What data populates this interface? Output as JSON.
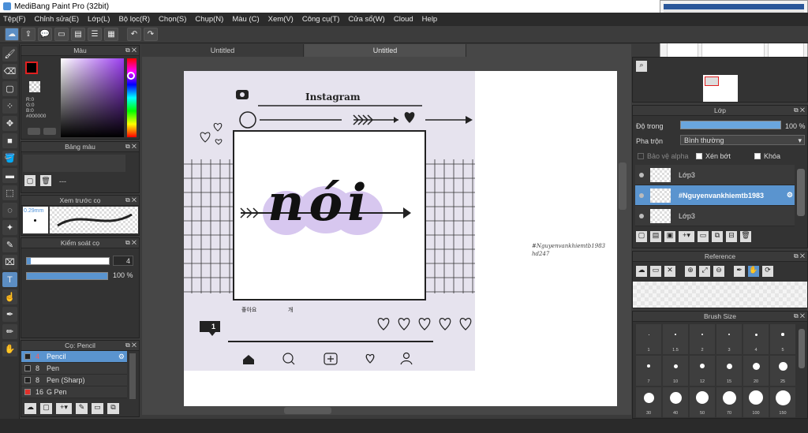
{
  "window": {
    "title": "MediBang Paint Pro (32bit)"
  },
  "menu": [
    "Tệp(F)",
    "Chỉnh sửa(E)",
    "Lớp(L)",
    "Bộ lọc(R)",
    "Chọn(S)",
    "Chụp(N)",
    "Màu (C)",
    "Xem(V)",
    "Công cụ(T)",
    "Cửa sổ(W)",
    "Cloud",
    "Help"
  ],
  "color_panel": {
    "title": "Màu",
    "primary_color": "#000000",
    "r": "R:0",
    "g": "G:0",
    "b": "B:0",
    "hex": "#000000"
  },
  "palette_panel": {
    "title": "Bảng màu",
    "value": "---"
  },
  "brush_preview_panel": {
    "title": "Xem trước cọ",
    "size": "0.29mm"
  },
  "brush_control_panel": {
    "title": "Kiểm soát cọ",
    "size_value": "4",
    "opacity_value": "100 %",
    "size_level": 0.95,
    "opacity_level": 1.0
  },
  "brush_list_panel": {
    "title": "Cọ: Pencil",
    "items": [
      {
        "size": "4",
        "name": "Pencil",
        "selected": true,
        "swatch": "#222222"
      },
      {
        "size": "8",
        "name": "Pen",
        "selected": false,
        "swatch": "#222222"
      },
      {
        "size": "8",
        "name": "Pen (Sharp)",
        "selected": false,
        "swatch": "#222222"
      },
      {
        "size": "16",
        "name": "G Pen",
        "selected": false,
        "swatch": "#e0302a"
      }
    ]
  },
  "tabs": [
    "Untitled",
    "Untitled"
  ],
  "artwork": {
    "header": "Instagram",
    "main_text": "nói",
    "likes": "1",
    "caption_korean": "좋아요",
    "caption_small": "개"
  },
  "canvas_signature": {
    "line1": "#Nguyenvankhiemtb1983",
    "line2": "hd247"
  },
  "layer_panel": {
    "title": "Lớp",
    "opacity_label": "Độ trong",
    "opacity_value": "100 %",
    "opacity_level": 1.0,
    "blend_label": "Pha trộn",
    "blend_value": "Bình thường",
    "protect_alpha": "Bảo vệ alpha",
    "clipping": "Xén bớt",
    "lock": "Khóa",
    "layers": [
      {
        "name": "Lớp3",
        "selected": false
      },
      {
        "name": "#Nguyenvankhiemtb1983",
        "selected": true
      },
      {
        "name": "Lớp3",
        "selected": false
      }
    ]
  },
  "reference_panel": {
    "title": "Reference"
  },
  "brush_size_panel": {
    "title": "Brush Size",
    "sizes": [
      "1",
      "1.5",
      "2",
      "3",
      "4",
      "5",
      "7",
      "10",
      "12",
      "15",
      "20",
      "25",
      "30",
      "40",
      "50",
      "70",
      "100",
      "150"
    ]
  }
}
